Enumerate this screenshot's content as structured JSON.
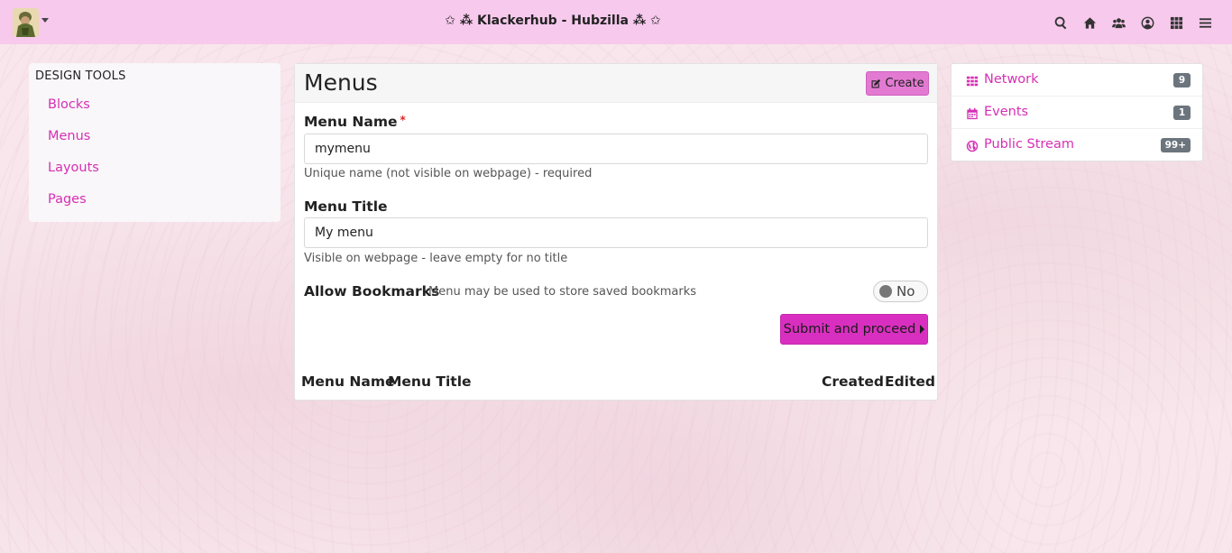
{
  "navbar": {
    "site_title": "✩ ⁂ Klackerhub - Hubzilla ⁂ ✩",
    "icons": [
      "search-icon",
      "home-icon",
      "users-icon",
      "user-circle-icon",
      "apps-grid-icon",
      "menu-bars-icon"
    ]
  },
  "sidebar_left": {
    "title": "DESIGN TOOLS",
    "items": [
      {
        "label": "Blocks"
      },
      {
        "label": "Menus"
      },
      {
        "label": "Layouts"
      },
      {
        "label": "Pages"
      }
    ]
  },
  "main": {
    "title": "Menus",
    "create_label": "Create",
    "menu_name": {
      "label": "Menu Name",
      "required_mark": "*",
      "value": "mymenu",
      "help": "Unique name (not visible on webpage) - required"
    },
    "menu_title": {
      "label": "Menu Title",
      "value": "My menu",
      "help": "Visible on webpage - leave empty for no title"
    },
    "bookmarks": {
      "label": "Allow Bookmarks",
      "help": "Menu may be used to store saved bookmarks",
      "toggle_text": "No"
    },
    "submit_label": "Submit and proceed",
    "table_headers": [
      "Menu Name",
      "Menu Title",
      "Created",
      "Edited"
    ]
  },
  "sidebar_right": {
    "items": [
      {
        "label": "Network",
        "badge": "9",
        "icon": "grid-icon"
      },
      {
        "label": "Events",
        "badge": "1",
        "icon": "calendar-icon"
      },
      {
        "label": "Public Stream",
        "badge": "99+",
        "icon": "globe-icon"
      }
    ]
  },
  "colors": {
    "navbar": "#f7c9ec",
    "accent": "#d62fb4",
    "submit": "#d92fc0",
    "create": "#e37ad2",
    "badge": "#6c757d"
  }
}
